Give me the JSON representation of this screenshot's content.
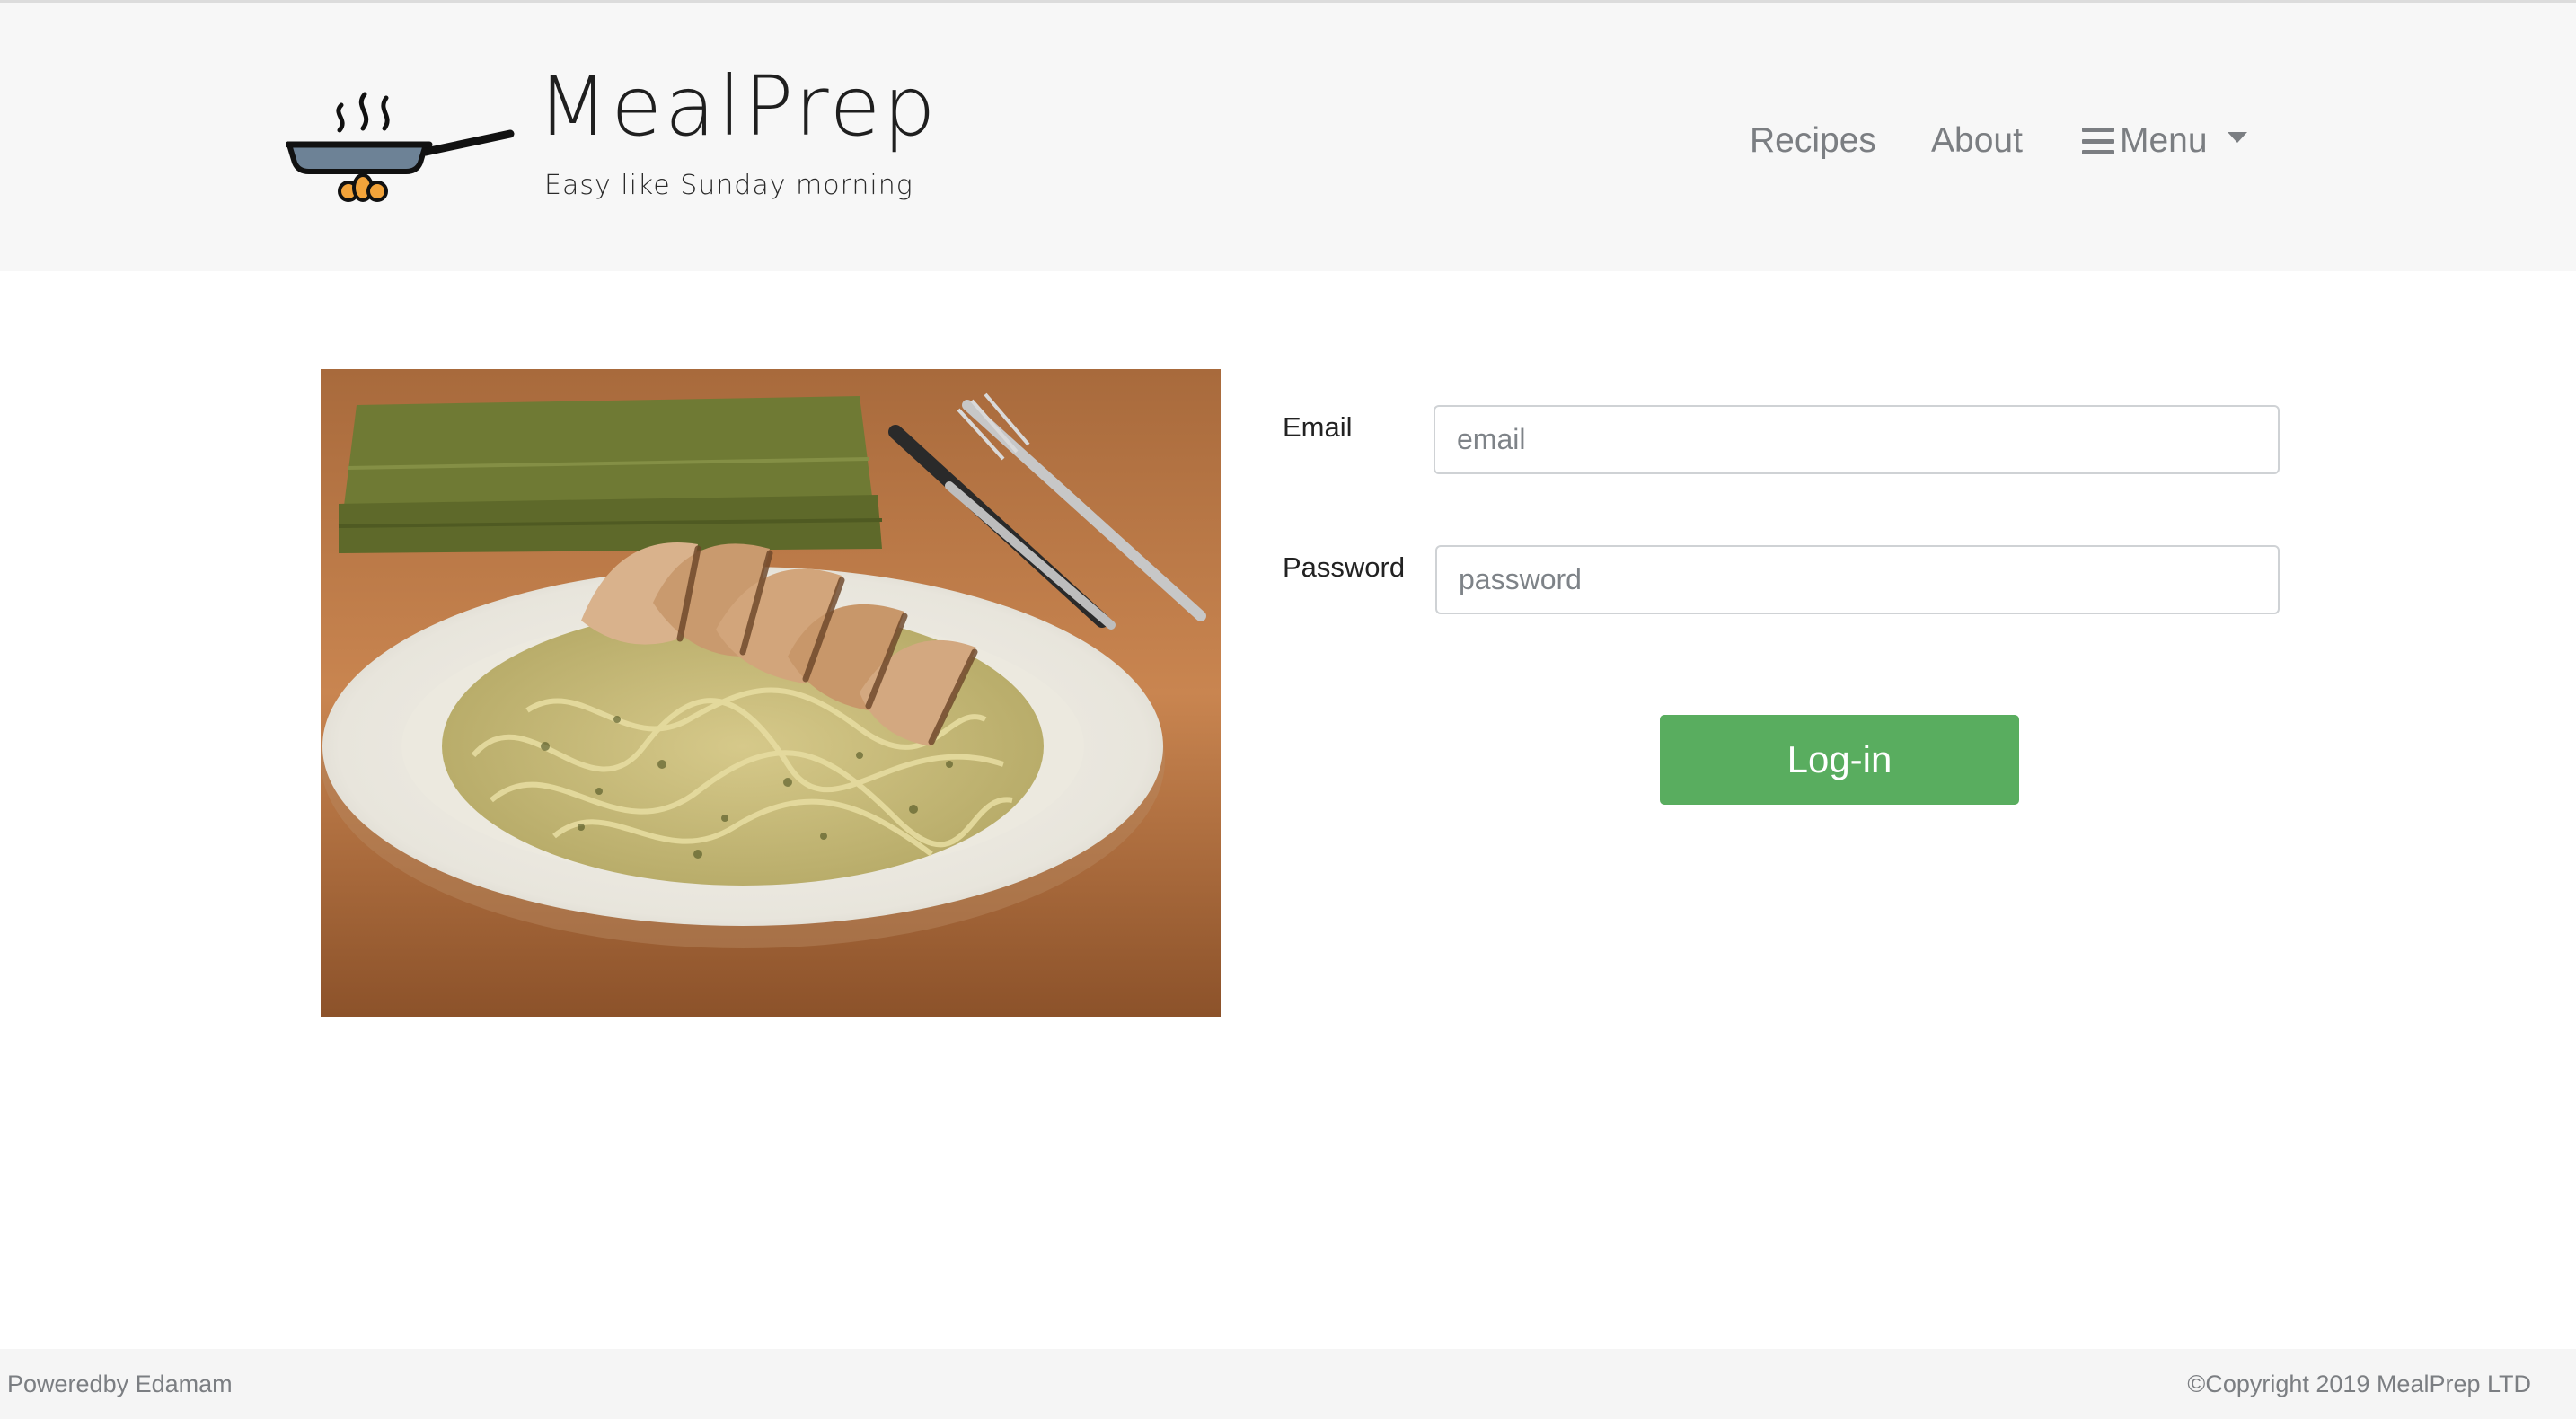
{
  "header": {
    "brand_title": "MealPrep",
    "brand_tagline": "Easy like Sunday morning",
    "logo_icon": "frying-pan-icon"
  },
  "nav": {
    "recipes_label": "Recipes",
    "about_label": "About",
    "menu_label": "Menu",
    "menu_icon": "hamburger-icon",
    "menu_caret_icon": "caret-down-icon"
  },
  "main": {
    "image_subject": "pesto-pasta-with-grilled-chicken",
    "login_form": {
      "email_label": "Email",
      "email_placeholder": "email",
      "email_value": "",
      "password_label": "Password",
      "password_placeholder": "password",
      "password_value": "",
      "submit_label": "Log-in"
    }
  },
  "footer": {
    "powered_by": "Poweredby Edamam",
    "copyright": "©Copyright 2019 MealPrep LTD"
  },
  "colors": {
    "header_bg": "#f7f7f7",
    "footer_bg": "#f5f5f5",
    "nav_text": "#7b7e82",
    "login_button": "#59ad5f",
    "input_border": "#cfd2d5"
  }
}
